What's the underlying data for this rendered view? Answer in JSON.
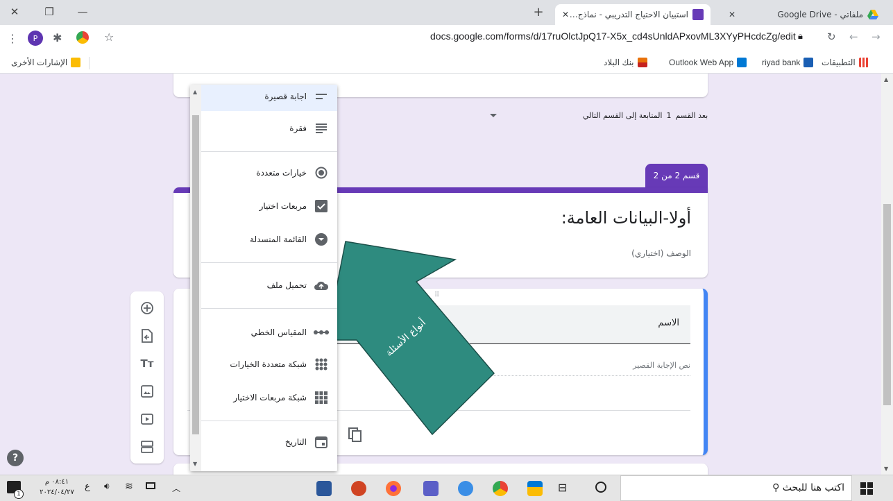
{
  "browser": {
    "tabs": [
      {
        "title": "ملفاتي - Google Drive"
      },
      {
        "title": "استبيان الاحتياج التدريبي - نماذج Goog"
      }
    ],
    "url": "docs.google.com/forms/d/17ruOlctJpQ17-X5x_cd4sUnldAPxovML3XYyPHcdcZg/edit",
    "profile_initial": "P",
    "bookmarks": [
      {
        "label": "التطبيقات"
      },
      {
        "label": "riyad bank"
      },
      {
        "label": "Outlook Web App"
      },
      {
        "label": "بنك البلاد"
      }
    ],
    "other_bookmarks": "الإشارات الأخرى"
  },
  "form": {
    "after_section": {
      "prefix": "بعد القسم",
      "number": "1",
      "value": "المتابعة إلى القسم التالي"
    },
    "section_badge": "قسم 2 من 2",
    "section_title": "أولا-البيانات العامة:",
    "section_description": "الوصف (اختياري)",
    "question_title": "الاسم",
    "answer_placeholder": "نص الإجابة القصير",
    "drag_handle": "⠿"
  },
  "type_menu": {
    "items": [
      {
        "label": "اجابة قصيرة",
        "icon": "short-answer-icon"
      },
      {
        "label": "فقرة",
        "icon": "paragraph-icon"
      },
      {
        "label": "خيارات متعددة",
        "icon": "radio-icon"
      },
      {
        "label": "مربعات اختيار",
        "icon": "checkbox-icon"
      },
      {
        "label": "القائمة المنسدلة",
        "icon": "dropdown-icon"
      },
      {
        "label": "تحميل ملف",
        "icon": "cloud-upload-icon"
      },
      {
        "label": "المقياس الخطي",
        "icon": "linear-scale-icon"
      },
      {
        "label": "شبكة متعددة الخيارات",
        "icon": "multiple-choice-grid-icon"
      },
      {
        "label": "شبكة مربعات الاختيار",
        "icon": "checkbox-grid-icon"
      },
      {
        "label": "التاريخ",
        "icon": "calendar-icon"
      }
    ]
  },
  "annotation": {
    "text": "أنواع الأسئلة",
    "color": "#2e8b7f"
  },
  "help": "?",
  "taskbar": {
    "search_placeholder": "اكتب هنا للبحث",
    "time": "٠٨:٤١ م",
    "date": "٢٠٢٤/٠٤/٢٧",
    "lang": "ع",
    "notif_count": "1"
  },
  "colors": {
    "accent": "#673ab7",
    "focus_bar": "#4285f4"
  }
}
